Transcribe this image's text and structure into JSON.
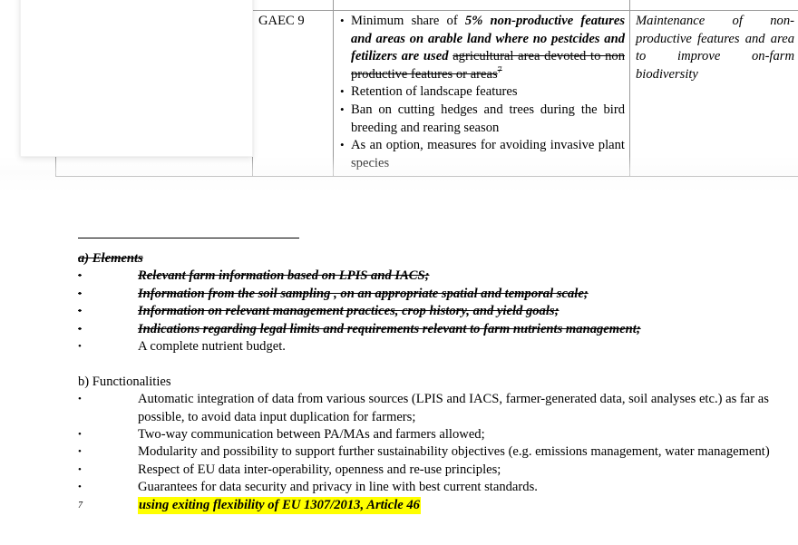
{
  "document": {
    "type": "regulation-excerpt"
  },
  "table": {
    "rows": [
      {
        "code": "GAEC 9",
        "requirements": [
          {
            "segments": [
              {
                "text": "Minimum share of ",
                "style": "plain"
              },
              {
                "text": "5% non-productive features and areas on arable land where no pestcides and fetilizers are used",
                "style": "bold-italic"
              },
              {
                "text": " ",
                "style": "plain"
              },
              {
                "text": "agricultural area devoted to non productive features or areas",
                "style": "struck"
              },
              {
                "text": "7",
                "style": "struck-superscript"
              }
            ]
          },
          {
            "segments": [
              {
                "text": "Retention of landscape features",
                "style": "plain"
              }
            ]
          },
          {
            "segments": [
              {
                "text": "Ban on cutting hedges and trees during the bird breeding and rearing season",
                "style": "plain"
              }
            ]
          },
          {
            "segments": [
              {
                "text": "As an option, measures for avoiding invasive plant species",
                "style": "plain"
              }
            ]
          }
        ],
        "objective": "Maintenance of non-productive features and area to improve on-farm biodiversity"
      }
    ]
  },
  "sections": [
    {
      "heading": "a) Elements",
      "heading_style": "struck-bold-italic",
      "items": [
        {
          "text": "Relevant farm information based on LPIS and IACS;",
          "style": "struck-bold-italic"
        },
        {
          "text": "Information from the soil sampling , on an appropriate spatial and temporal scale;",
          "style": "struck-bold-italic"
        },
        {
          "text": "Information on relevant management practices, crop history, and yield goals;",
          "style": "struck-bold-italic"
        },
        {
          "text": "Indications regarding legal limits and requirements relevant to farm nutrients management;",
          "style": "struck-bold-italic"
        },
        {
          "text": "A complete nutrient budget.",
          "style": "plain"
        }
      ]
    },
    {
      "heading": "b) Functionalities",
      "heading_style": "plain",
      "items": [
        {
          "text": "Automatic integration of data from various sources (LPIS and IACS, farmer-generated data, soil analyses etc.) as far as possible, to avoid data input duplication for farmers;",
          "style": "plain"
        },
        {
          "text": "Two-way communication between PA/MAs and farmers allowed;",
          "style": "plain"
        },
        {
          "text": "Modularity and possibility to support further sustainability objectives (e.g. emissions management, water management)",
          "style": "plain"
        },
        {
          "text": " Respect of EU data inter-operability, openness and re-use principles;",
          "style": "plain"
        },
        {
          "text": "Guarantees for data security and privacy in line with best current standards.",
          "style": "plain"
        }
      ]
    }
  ],
  "footnote": {
    "number": "7",
    "text": "using exiting flexibility of EU 1307/2013, Article 46",
    "highlight_color": "#ffff00"
  },
  "bullet_glyph": "•"
}
